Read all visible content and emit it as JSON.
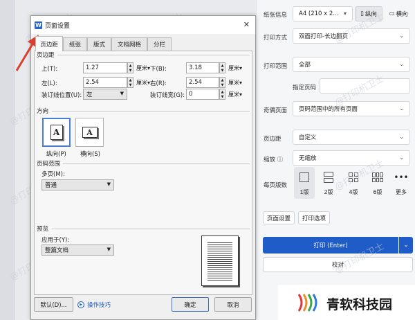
{
  "right_panel": {
    "paper_info_label": "纸张信息",
    "paper_value": "A4 (210 x 2...",
    "portrait": "纵向",
    "landscape": "横向",
    "print_mode_label": "打印方式",
    "print_mode_value": "双面打印-长边翻页",
    "print_range_label": "打印范围",
    "print_range_value": "全部",
    "specify_pages_label": "指定页码",
    "odd_even_label": "奇偶页面",
    "odd_even_value": "页码范围中的所有页面",
    "margin_label": "页边距",
    "margin_value": "自定义",
    "zoom_label": "缩放",
    "zoom_value": "无缩放",
    "pages_per_sheet_label": "每页版数",
    "pages_options": [
      "1版",
      "2版",
      "4版",
      "6版",
      "更多"
    ],
    "page_setup_btn": "页面设置",
    "print_options_btn": "打印选项",
    "print_btn": "打印 (Enter)",
    "proofread_btn": "校对"
  },
  "dialog": {
    "title": "页面设置",
    "tabs": [
      "页边距",
      "纸张",
      "版式",
      "文档网格",
      "分栏"
    ],
    "margins_section": "页边距",
    "top_label": "上(T):",
    "top_value": "1.27",
    "bottom_label": "下(B):",
    "bottom_value": "3.18",
    "left_label": "左(L):",
    "left_value": "2.54",
    "right_label": "右(R):",
    "right_value": "2.54",
    "gutter_pos_label": "装订线位置(U):",
    "gutter_pos_value": "左",
    "gutter_width_label": "装订线宽(G):",
    "gutter_width_value": "0",
    "unit": "厘米▾",
    "orientation_section": "方向",
    "portrait_label": "纵向(P)",
    "landscape_label": "横向(S)",
    "page_range_section": "页码范围",
    "multi_page_label": "多页(M):",
    "multi_page_value": "普通",
    "preview_section": "预览",
    "apply_to_label": "应用于(Y):",
    "apply_to_value": "整篇文档",
    "default_btn": "默认(D)...",
    "tips_label": "操作技巧",
    "ok_btn": "确定",
    "cancel_btn": "取消",
    "close_symbol": "✕"
  },
  "watermark": {
    "text": "@打印机卫士",
    "brand": "青软科技园"
  },
  "colors": {
    "accent": "#1f5cc8",
    "arrow": "#d93f2b",
    "brand": "#1a1a1a"
  }
}
